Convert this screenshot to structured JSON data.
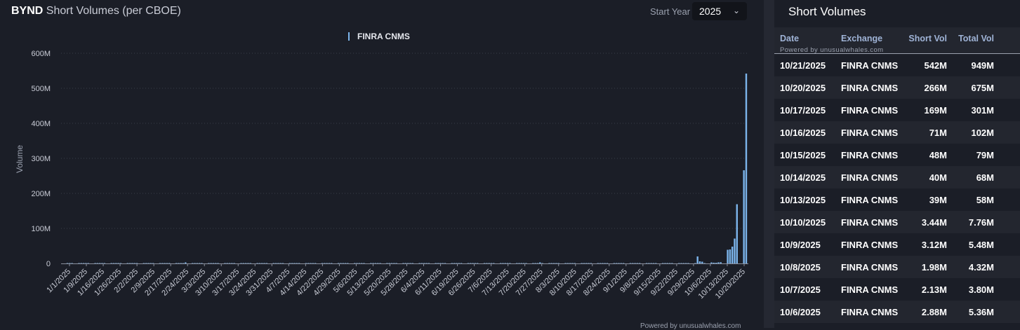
{
  "header": {
    "ticker": "BYND",
    "title_rest": " Short Volumes (per CBOE)",
    "start_year_label": "Start Year",
    "start_year_value": "2025"
  },
  "chart_data": {
    "type": "bar",
    "legend": [
      "FINRA CNMS"
    ],
    "series_color": "#7cb5ec",
    "ylabel": "Volume",
    "ylim": [
      0,
      600000000
    ],
    "yticks": [
      "0",
      "100M",
      "200M",
      "300M",
      "400M",
      "500M",
      "600M"
    ],
    "xticks": [
      "1/1/2025",
      "1/9/2025",
      "1/16/2025",
      "1/26/2025",
      "2/2/2025",
      "2/9/2025",
      "2/17/2025",
      "2/24/2025",
      "3/3/2025",
      "3/10/2025",
      "3/17/2025",
      "3/24/2025",
      "3/31/2025",
      "4/7/2025",
      "4/14/2025",
      "4/22/2025",
      "4/29/2025",
      "5/6/2025",
      "5/13/2025",
      "5/20/2025",
      "5/28/2025",
      "6/4/2025",
      "6/11/2025",
      "6/19/2025",
      "6/26/2025",
      "7/6/2025",
      "7/13/2025",
      "7/20/2025",
      "7/27/2025",
      "8/3/2025",
      "8/10/2025",
      "8/17/2025",
      "8/24/2025",
      "9/1/2025",
      "9/8/2025",
      "9/15/2025",
      "9/22/2025",
      "9/29/2025",
      "10/6/2025",
      "10/13/2025",
      "10/20/2025"
    ],
    "notable_values": [
      {
        "date": "2/21/2025",
        "value": 3000000
      },
      {
        "date": "7/24/2025",
        "value": 3000000
      },
      {
        "date": "7/26/2025",
        "value": 3000000
      },
      {
        "date": "9/30/2025",
        "value": 20000000
      },
      {
        "date": "10/1/2025",
        "value": 6000000
      },
      {
        "date": "10/2/2025",
        "value": 5000000
      },
      {
        "date": "10/6/2025",
        "value": 2880000
      },
      {
        "date": "10/7/2025",
        "value": 2130000
      },
      {
        "date": "10/8/2025",
        "value": 1980000
      },
      {
        "date": "10/9/2025",
        "value": 3120000
      },
      {
        "date": "10/10/2025",
        "value": 3440000
      },
      {
        "date": "10/13/2025",
        "value": 39000000
      },
      {
        "date": "10/14/2025",
        "value": 40000000
      },
      {
        "date": "10/15/2025",
        "value": 48000000
      },
      {
        "date": "10/16/2025",
        "value": 71000000
      },
      {
        "date": "10/17/2025",
        "value": 169000000
      },
      {
        "date": "10/20/2025",
        "value": 266000000
      },
      {
        "date": "10/21/2025",
        "value": 542000000
      }
    ],
    "baseline_value": 600000
  },
  "powered_by": "Powered by unusualwhales.com",
  "panel": {
    "title": "Short Volumes",
    "columns": [
      "Date",
      "Exchange",
      "Short Vol",
      "Total Vol"
    ],
    "rows": [
      [
        "10/21/2025",
        "FINRA CNMS",
        "542M",
        "949M"
      ],
      [
        "10/20/2025",
        "FINRA CNMS",
        "266M",
        "675M"
      ],
      [
        "10/17/2025",
        "FINRA CNMS",
        "169M",
        "301M"
      ],
      [
        "10/16/2025",
        "FINRA CNMS",
        "71M",
        "102M"
      ],
      [
        "10/15/2025",
        "FINRA CNMS",
        "48M",
        "79M"
      ],
      [
        "10/14/2025",
        "FINRA CNMS",
        "40M",
        "68M"
      ],
      [
        "10/13/2025",
        "FINRA CNMS",
        "39M",
        "58M"
      ],
      [
        "10/10/2025",
        "FINRA CNMS",
        "3.44M",
        "7.76M"
      ],
      [
        "10/9/2025",
        "FINRA CNMS",
        "3.12M",
        "5.48M"
      ],
      [
        "10/8/2025",
        "FINRA CNMS",
        "1.98M",
        "4.32M"
      ],
      [
        "10/7/2025",
        "FINRA CNMS",
        "2.13M",
        "3.80M"
      ],
      [
        "10/6/2025",
        "FINRA CNMS",
        "2.88M",
        "5.36M"
      ]
    ]
  }
}
